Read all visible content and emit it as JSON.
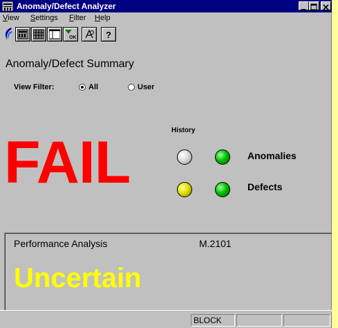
{
  "window": {
    "title": "Anomaly/Defect Analyzer",
    "buttons": [
      "minimize-button",
      "maximize-button",
      "close-button"
    ]
  },
  "menu": {
    "items": [
      {
        "label": "View",
        "hotkey": "V"
      },
      {
        "label": "Settings",
        "hotkey": "S"
      },
      {
        "label": "Filter",
        "hotkey": "F"
      },
      {
        "label": "Help",
        "hotkey": "H"
      }
    ]
  },
  "toolbar": {
    "icons": [
      "app-logo-icon",
      "summary-view-icon",
      "grid-view-icon",
      "panel-view-icon",
      "filter-ok-icon",
      "hierarchy-icon",
      "help-icon"
    ]
  },
  "summary": {
    "title": "Anomaly/Defect Summary",
    "view_filter_label": "View Filter:",
    "options": [
      {
        "label": "All",
        "selected": true
      },
      {
        "label": "User",
        "selected": false
      }
    ],
    "status_text": "FAIL",
    "status_color": "#ff0000",
    "history_label": "History",
    "rows": [
      {
        "label": "Anomalies",
        "history_color": "#e0e0e0",
        "current_color": "#00c000"
      },
      {
        "label": "Defects",
        "history_color": "#e0e000",
        "current_color": "#00c000"
      }
    ]
  },
  "performance": {
    "title": "Performance Analysis",
    "standard": "M.2101",
    "result": "Uncertain",
    "result_color": "#ffff00"
  },
  "statusbar": {
    "cells": [
      "BLOCK",
      "",
      ""
    ]
  }
}
